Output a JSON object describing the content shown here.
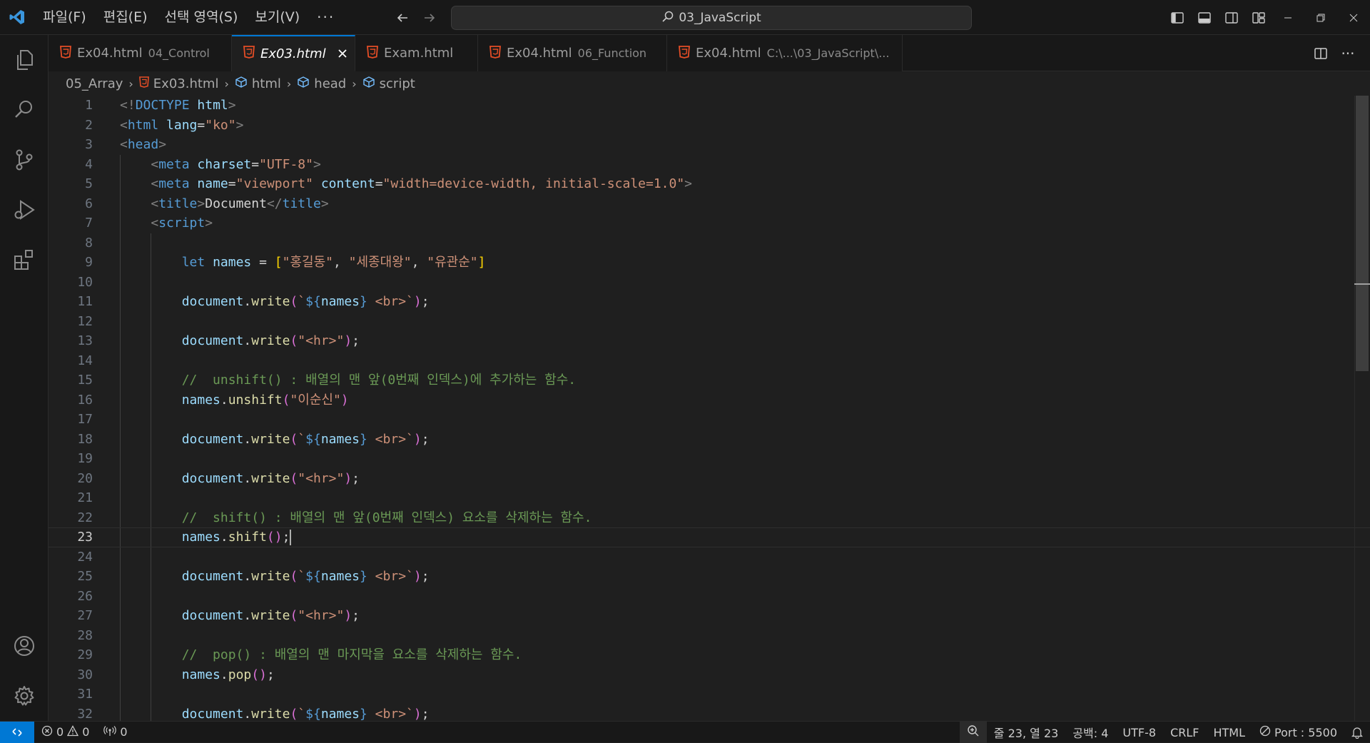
{
  "menu": [
    "파일(F)",
    "편집(E)",
    "선택 영역(S)",
    "보기(V)"
  ],
  "menu_more": "···",
  "command_center": "03_JavaScript",
  "tabs": [
    {
      "name": "Ex04.html",
      "desc": "04_Control",
      "active": false
    },
    {
      "name": "Ex03.html",
      "desc": "",
      "active": true
    },
    {
      "name": "Exam.html",
      "desc": "",
      "active": false
    },
    {
      "name": "Ex04.html",
      "desc": "06_Function",
      "active": false
    },
    {
      "name": "Ex04.html",
      "desc": "C:\\...\\03_JavaScript\\...",
      "active": false
    }
  ],
  "tab_more": "···",
  "breadcrumbs": [
    "05_Array",
    "Ex03.html",
    "html",
    "head",
    "script"
  ],
  "editor": {
    "current_line": 23,
    "lines": [
      {
        "n": "1",
        "tokens": [
          [
            "p",
            "<!"
          ],
          [
            "t",
            "DOCTYPE"
          ],
          [
            "x",
            " "
          ],
          [
            "a",
            "html"
          ],
          [
            "p",
            ">"
          ]
        ]
      },
      {
        "n": "2",
        "tokens": [
          [
            "p",
            "<"
          ],
          [
            "t",
            "html"
          ],
          [
            "x",
            " "
          ],
          [
            "a",
            "lang"
          ],
          [
            "x",
            "="
          ],
          [
            "s",
            "\"ko\""
          ],
          [
            "p",
            ">"
          ]
        ]
      },
      {
        "n": "3",
        "tokens": [
          [
            "p",
            "<"
          ],
          [
            "t",
            "head"
          ],
          [
            "p",
            ">"
          ]
        ]
      },
      {
        "n": "4",
        "tokens": [
          [
            "x",
            "    "
          ],
          [
            "p",
            "<"
          ],
          [
            "t",
            "meta"
          ],
          [
            "x",
            " "
          ],
          [
            "a",
            "charset"
          ],
          [
            "x",
            "="
          ],
          [
            "s",
            "\"UTF-8\""
          ],
          [
            "p",
            ">"
          ]
        ]
      },
      {
        "n": "5",
        "tokens": [
          [
            "x",
            "    "
          ],
          [
            "p",
            "<"
          ],
          [
            "t",
            "meta"
          ],
          [
            "x",
            " "
          ],
          [
            "a",
            "name"
          ],
          [
            "x",
            "="
          ],
          [
            "s",
            "\"viewport\""
          ],
          [
            "x",
            " "
          ],
          [
            "a",
            "content"
          ],
          [
            "x",
            "="
          ],
          [
            "s",
            "\"width=device-width, initial-scale=1.0\""
          ],
          [
            "p",
            ">"
          ]
        ]
      },
      {
        "n": "6",
        "tokens": [
          [
            "x",
            "    "
          ],
          [
            "p",
            "<"
          ],
          [
            "t",
            "title"
          ],
          [
            "p",
            ">"
          ],
          [
            "x",
            "Document"
          ],
          [
            "p",
            "</"
          ],
          [
            "t",
            "title"
          ],
          [
            "p",
            ">"
          ]
        ]
      },
      {
        "n": "7",
        "tokens": [
          [
            "x",
            "    "
          ],
          [
            "p",
            "<"
          ],
          [
            "t",
            "script"
          ],
          [
            "p",
            ">"
          ]
        ]
      },
      {
        "n": "8",
        "tokens": []
      },
      {
        "n": "9",
        "tokens": [
          [
            "x",
            "        "
          ],
          [
            "k",
            "let"
          ],
          [
            "x",
            " "
          ],
          [
            "v",
            "names"
          ],
          [
            "x",
            " = "
          ],
          [
            "b",
            "["
          ],
          [
            "s",
            "\"홍길동\""
          ],
          [
            "x",
            ", "
          ],
          [
            "s",
            "\"세종대왕\""
          ],
          [
            "x",
            ", "
          ],
          [
            "s",
            "\"유관순\""
          ],
          [
            "b",
            "]"
          ]
        ]
      },
      {
        "n": "10",
        "tokens": []
      },
      {
        "n": "11",
        "tokens": [
          [
            "x",
            "        "
          ],
          [
            "v",
            "document"
          ],
          [
            "x",
            "."
          ],
          [
            "f",
            "write"
          ],
          [
            "r",
            "("
          ],
          [
            "s",
            "`"
          ],
          [
            "k",
            "${"
          ],
          [
            "v",
            "names"
          ],
          [
            "k",
            "}"
          ],
          [
            "s",
            " <br>`"
          ],
          [
            "r",
            ")"
          ],
          [
            "x",
            ";"
          ]
        ]
      },
      {
        "n": "12",
        "tokens": []
      },
      {
        "n": "13",
        "tokens": [
          [
            "x",
            "        "
          ],
          [
            "v",
            "document"
          ],
          [
            "x",
            "."
          ],
          [
            "f",
            "write"
          ],
          [
            "r",
            "("
          ],
          [
            "s",
            "\"<hr>\""
          ],
          [
            "r",
            ")"
          ],
          [
            "x",
            ";"
          ]
        ]
      },
      {
        "n": "14",
        "tokens": []
      },
      {
        "n": "15",
        "tokens": [
          [
            "x",
            "        "
          ],
          [
            "c",
            "//  unshift() : 배열의 맨 앞(0번째 인덱스)에 추가하는 함수."
          ]
        ]
      },
      {
        "n": "16",
        "tokens": [
          [
            "x",
            "        "
          ],
          [
            "v",
            "names"
          ],
          [
            "x",
            "."
          ],
          [
            "f",
            "unshift"
          ],
          [
            "r",
            "("
          ],
          [
            "s",
            "\"이순신\""
          ],
          [
            "r",
            ")"
          ]
        ]
      },
      {
        "n": "17",
        "tokens": []
      },
      {
        "n": "18",
        "tokens": [
          [
            "x",
            "        "
          ],
          [
            "v",
            "document"
          ],
          [
            "x",
            "."
          ],
          [
            "f",
            "write"
          ],
          [
            "r",
            "("
          ],
          [
            "s",
            "`"
          ],
          [
            "k",
            "${"
          ],
          [
            "v",
            "names"
          ],
          [
            "k",
            "}"
          ],
          [
            "s",
            " <br>`"
          ],
          [
            "r",
            ")"
          ],
          [
            "x",
            ";"
          ]
        ]
      },
      {
        "n": "19",
        "tokens": []
      },
      {
        "n": "20",
        "tokens": [
          [
            "x",
            "        "
          ],
          [
            "v",
            "document"
          ],
          [
            "x",
            "."
          ],
          [
            "f",
            "write"
          ],
          [
            "r",
            "("
          ],
          [
            "s",
            "\"<hr>\""
          ],
          [
            "r",
            ")"
          ],
          [
            "x",
            ";"
          ]
        ]
      },
      {
        "n": "21",
        "tokens": []
      },
      {
        "n": "22",
        "tokens": [
          [
            "x",
            "        "
          ],
          [
            "c",
            "//  shift() : 배열의 맨 앞(0번째 인덱스) 요소를 삭제하는 함수."
          ]
        ]
      },
      {
        "n": "23",
        "tokens": [
          [
            "x",
            "        "
          ],
          [
            "v",
            "names"
          ],
          [
            "x",
            "."
          ],
          [
            "f",
            "shift"
          ],
          [
            "r",
            "("
          ],
          [
            "r",
            ")"
          ],
          [
            "x",
            ";"
          ]
        ]
      },
      {
        "n": "24",
        "tokens": []
      },
      {
        "n": "25",
        "tokens": [
          [
            "x",
            "        "
          ],
          [
            "v",
            "document"
          ],
          [
            "x",
            "."
          ],
          [
            "f",
            "write"
          ],
          [
            "r",
            "("
          ],
          [
            "s",
            "`"
          ],
          [
            "k",
            "${"
          ],
          [
            "v",
            "names"
          ],
          [
            "k",
            "}"
          ],
          [
            "s",
            " <br>`"
          ],
          [
            "r",
            ")"
          ],
          [
            "x",
            ";"
          ]
        ]
      },
      {
        "n": "26",
        "tokens": []
      },
      {
        "n": "27",
        "tokens": [
          [
            "x",
            "        "
          ],
          [
            "v",
            "document"
          ],
          [
            "x",
            "."
          ],
          [
            "f",
            "write"
          ],
          [
            "r",
            "("
          ],
          [
            "s",
            "\"<hr>\""
          ],
          [
            "r",
            ")"
          ],
          [
            "x",
            ";"
          ]
        ]
      },
      {
        "n": "28",
        "tokens": []
      },
      {
        "n": "29",
        "tokens": [
          [
            "x",
            "        "
          ],
          [
            "c",
            "//  pop() : 배열의 맨 마지막을 요소를 삭제하는 함수."
          ]
        ]
      },
      {
        "n": "30",
        "tokens": [
          [
            "x",
            "        "
          ],
          [
            "v",
            "names"
          ],
          [
            "x",
            "."
          ],
          [
            "f",
            "pop"
          ],
          [
            "r",
            "("
          ],
          [
            "r",
            ")"
          ],
          [
            "x",
            ";"
          ]
        ]
      },
      {
        "n": "31",
        "tokens": []
      },
      {
        "n": "32",
        "tokens": [
          [
            "x",
            "        "
          ],
          [
            "v",
            "document"
          ],
          [
            "x",
            "."
          ],
          [
            "f",
            "write"
          ],
          [
            "r",
            "("
          ],
          [
            "s",
            "`"
          ],
          [
            "k",
            "${"
          ],
          [
            "v",
            "names"
          ],
          [
            "k",
            "}"
          ],
          [
            "s",
            " <br>`"
          ],
          [
            "r",
            ")"
          ],
          [
            "x",
            ";"
          ]
        ]
      }
    ]
  },
  "status": {
    "errors": "0",
    "warnings": "0",
    "ports": "0",
    "cursor_pos": "줄 23, 열 23",
    "indent": "공백: 4",
    "encoding": "UTF-8",
    "eol": "CRLF",
    "language": "HTML",
    "port": "Port : 5500"
  },
  "colors": {
    "accent": "#0078d4",
    "html_icon": "#e44d26"
  }
}
